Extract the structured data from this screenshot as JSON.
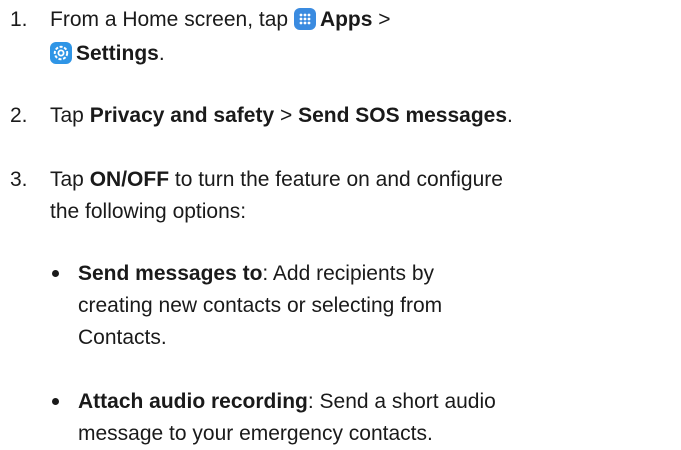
{
  "steps": [
    {
      "number": "1.",
      "prefix": "From a Home screen, tap",
      "apps": "Apps",
      "sep": ">",
      "settings": "Settings",
      "end": "."
    },
    {
      "number": "2.",
      "prefix": "Tap",
      "bold1": "Privacy and safety",
      "sep": ">",
      "bold2": "Send SOS messages",
      "end": "."
    },
    {
      "number": "3.",
      "prefix": "Tap",
      "bold": "ON/OFF",
      "line1_rest": "to turn the feature on and configure",
      "line2": "the following options:"
    }
  ],
  "bullets": [
    {
      "term": "Send messages to",
      "line1_rest": ": Add recipients by",
      "line2": "creating new contacts or selecting from",
      "line3": "Contacts."
    },
    {
      "term": "Attach audio recording",
      "line1_rest": ": Send a short audio",
      "line2": "message to your emergency contacts."
    }
  ],
  "icons": {
    "apps": "apps-grid-icon",
    "settings": "settings-gear-icon"
  }
}
